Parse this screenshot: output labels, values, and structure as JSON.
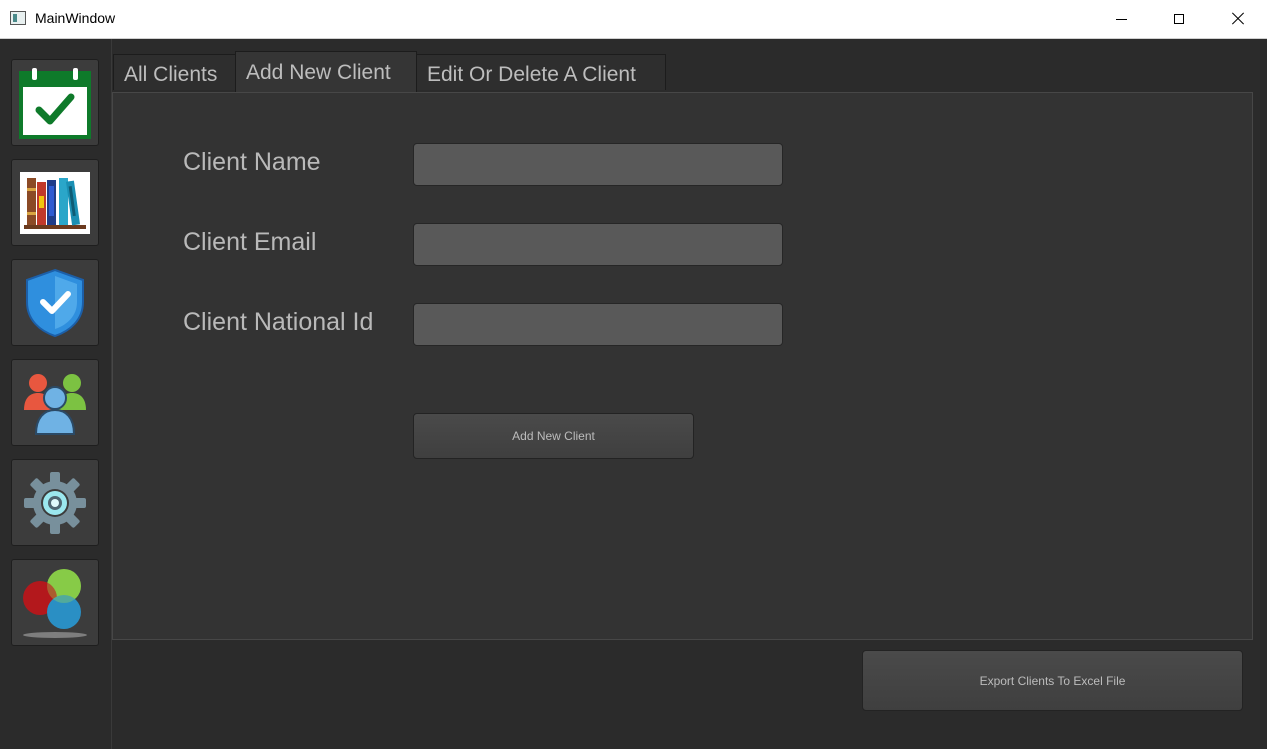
{
  "window": {
    "title": "MainWindow",
    "controls": [
      "minimize-icon",
      "maximize-icon",
      "close-icon"
    ]
  },
  "sidebar": {
    "items": [
      {
        "icon": "calendar-check-icon",
        "colors": {
          "frame": "#0e7a2a",
          "check": "#0e7a2a"
        }
      },
      {
        "icon": "books-icon"
      },
      {
        "icon": "shield-check-icon",
        "colors": {
          "shield": "#2f8fde"
        }
      },
      {
        "icon": "users-icon"
      },
      {
        "icon": "gear-icon"
      },
      {
        "icon": "color-circles-icon"
      }
    ]
  },
  "tabs": [
    {
      "label": "All Clients",
      "active": false
    },
    {
      "label": "Add New Client",
      "active": true
    },
    {
      "label": "Edit Or Delete A Client",
      "active": false
    }
  ],
  "form": {
    "client_name": {
      "label": "Client Name",
      "value": "",
      "placeholder": ""
    },
    "client_email": {
      "label": "Client Email",
      "value": "",
      "placeholder": ""
    },
    "client_national_id": {
      "label": "Client National Id",
      "value": "",
      "placeholder": ""
    },
    "submit_label": "Add New Client"
  },
  "footer": {
    "export_label": "Export Clients To Excel File"
  },
  "theme": {
    "background": "#2b2b2b",
    "panel": "#333333",
    "input": "#595959",
    "text": "#b9b9b9"
  }
}
